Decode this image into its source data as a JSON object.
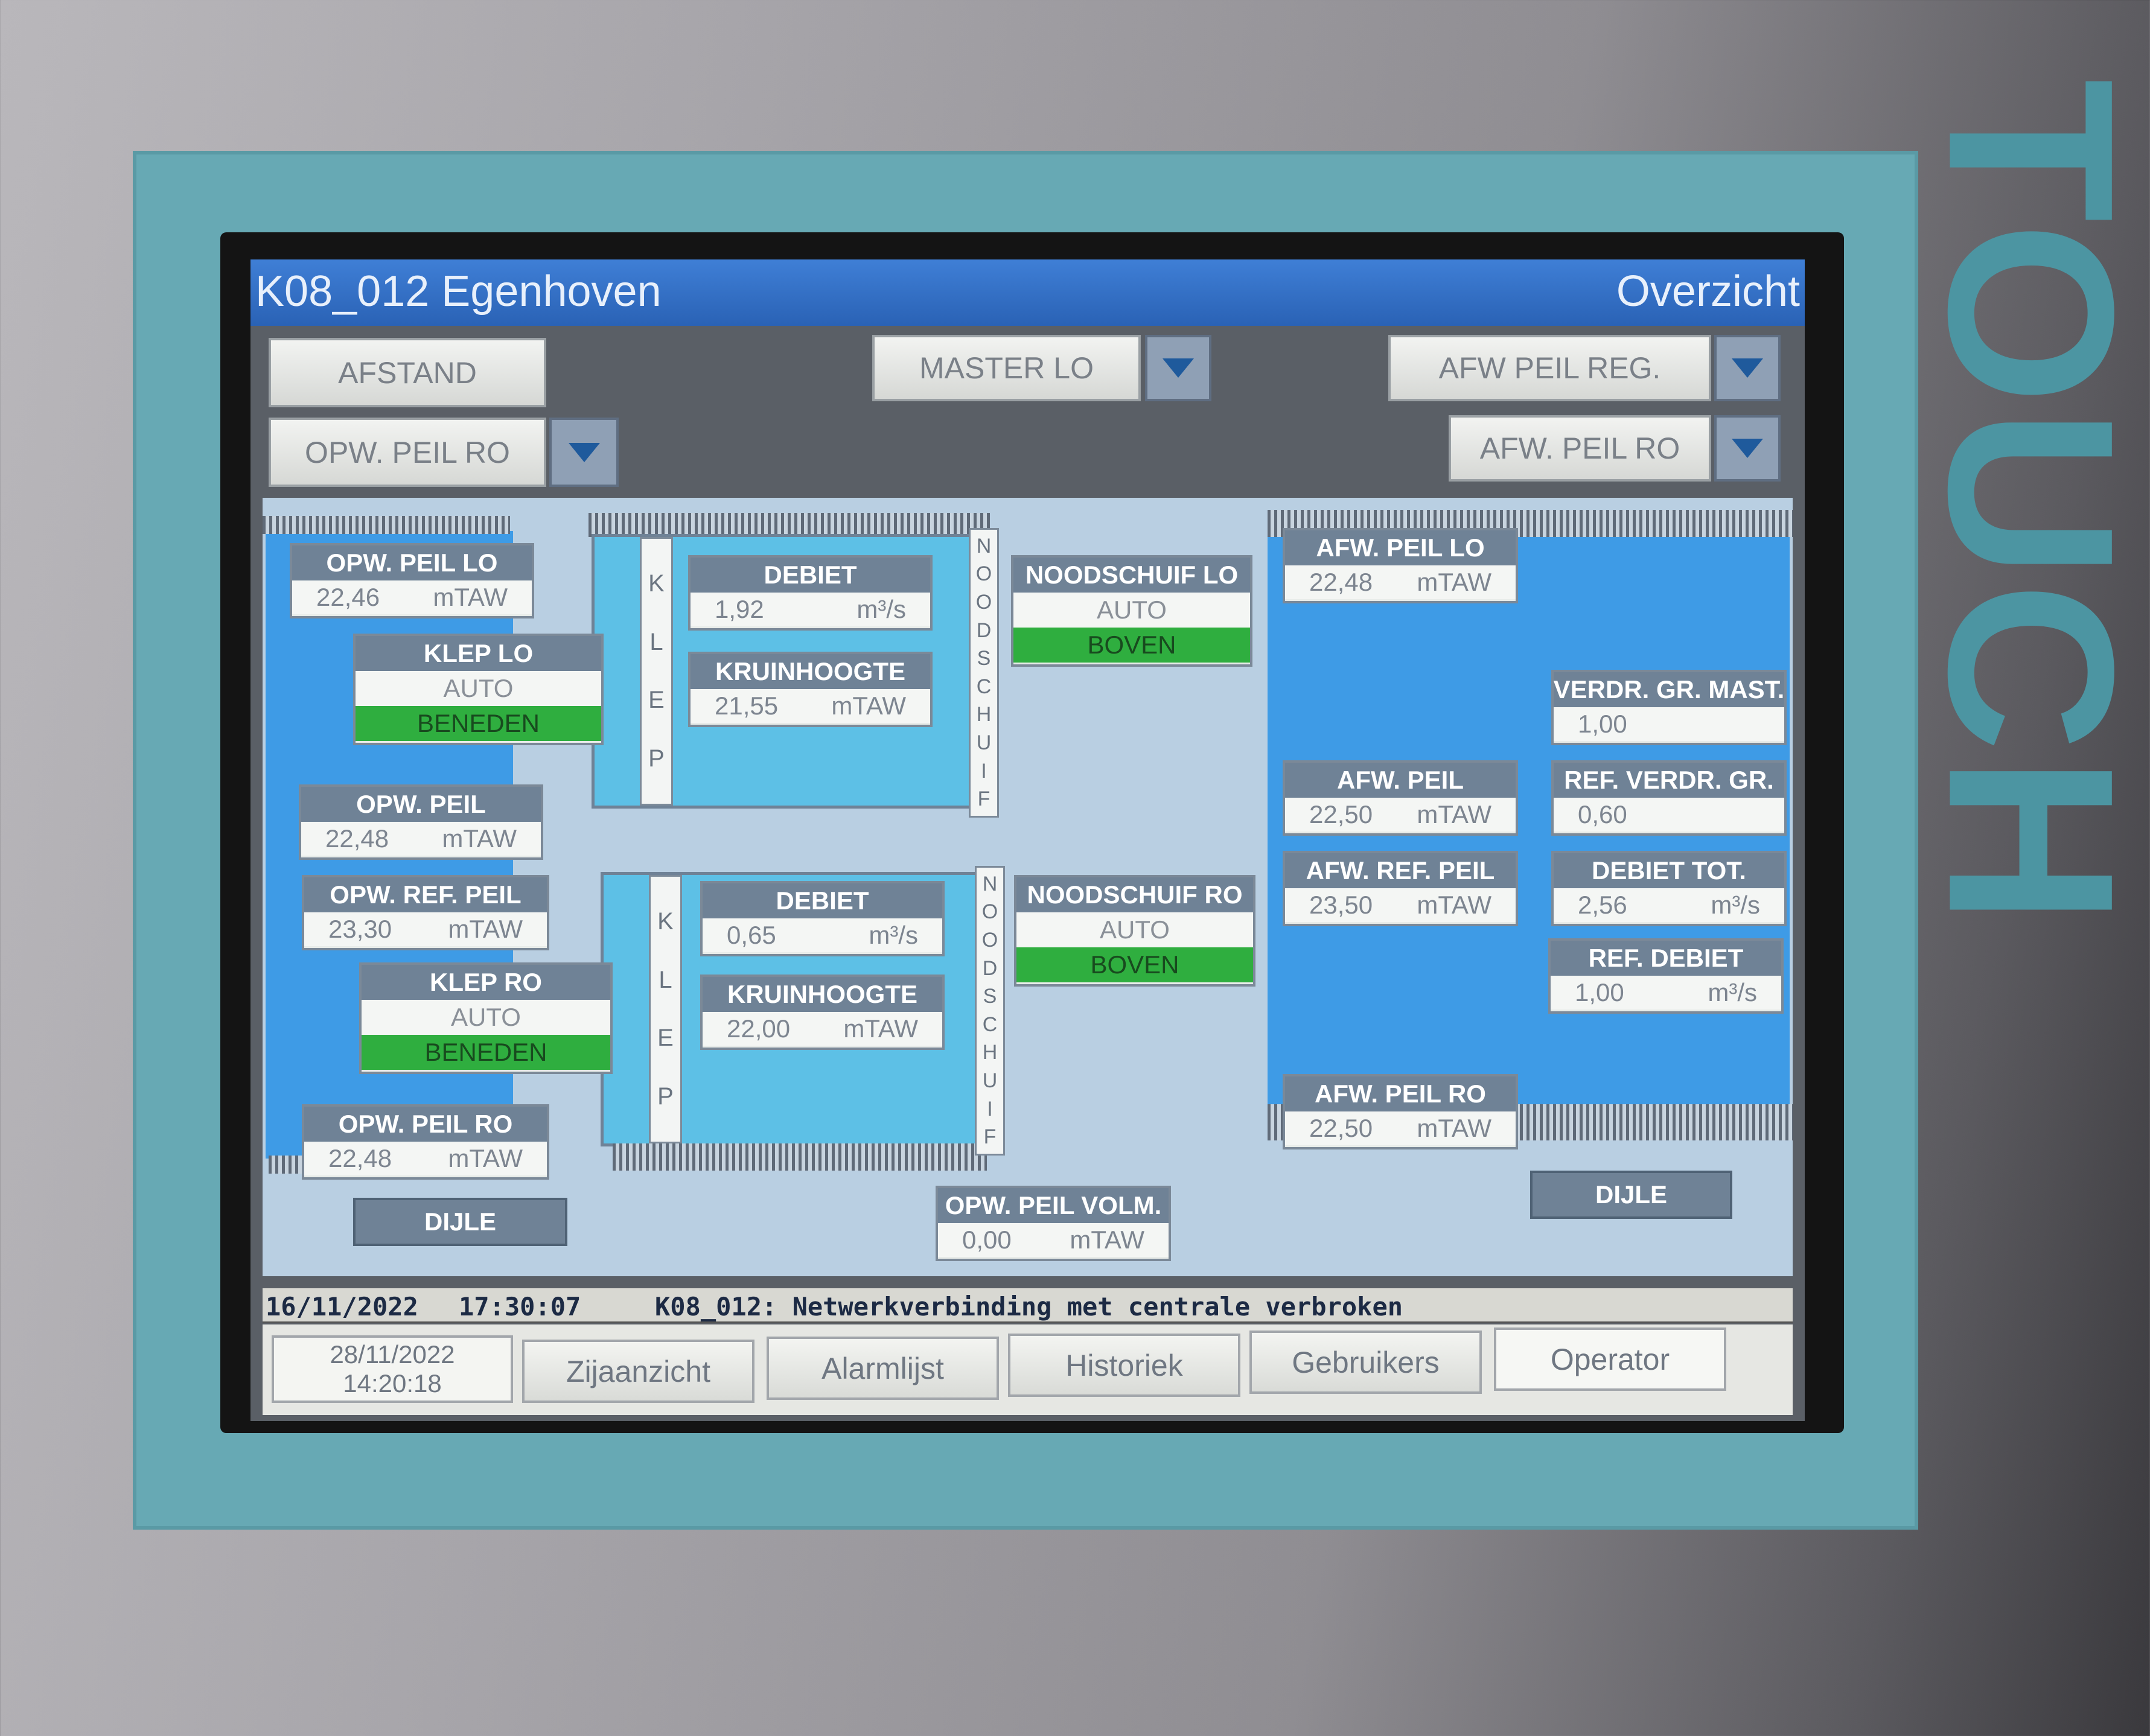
{
  "device": {
    "brand": "TOUCH"
  },
  "header": {
    "station": "K08_012 Egenhoven",
    "view": "Overzicht"
  },
  "controls": {
    "afstand": "AFSTAND",
    "master": "MASTER LO",
    "afw_peil_reg": "AFW PEIL REG.",
    "opw_peil_ro": "OPW. PEIL RO",
    "afw_peil_ro": "AFW. PEIL RO"
  },
  "left": {
    "opw_peil_lo": {
      "title": "OPW. PEIL LO",
      "value": "22,46",
      "unit": "mTAW"
    },
    "klep_lo": {
      "title": "KLEP LO",
      "mode": "AUTO",
      "state": "BENEDEN"
    },
    "opw_peil": {
      "title": "OPW. PEIL",
      "value": "22,48",
      "unit": "mTAW"
    },
    "opw_ref_peil": {
      "title": "OPW. REF. PEIL",
      "value": "23,30",
      "unit": "mTAW"
    },
    "klep_ro": {
      "title": "KLEP RO",
      "mode": "AUTO",
      "state": "BENEDEN"
    },
    "opw_peil_ro": {
      "title": "OPW. PEIL RO",
      "value": "22,48",
      "unit": "mTAW"
    },
    "river": "DIJLE"
  },
  "gate_top": {
    "klep_letters": [
      "K",
      "L",
      "E",
      "P"
    ],
    "debiet": {
      "title": "DEBIET",
      "value": "1,92",
      "unit": "m³/s"
    },
    "kruinhoogte": {
      "title": "KRUINHOOGTE",
      "value": "21,55",
      "unit": "mTAW"
    },
    "nood_letters": [
      "N",
      "O",
      "O",
      "D",
      "S",
      "C",
      "H",
      "U",
      "I",
      "F"
    ],
    "noodschuif": {
      "title": "NOODSCHUIF LO",
      "mode": "AUTO",
      "state": "BOVEN"
    }
  },
  "gate_bottom": {
    "klep_letters": [
      "K",
      "L",
      "E",
      "P"
    ],
    "debiet": {
      "title": "DEBIET",
      "value": "0,65",
      "unit": "m³/s"
    },
    "kruinhoogte": {
      "title": "KRUINHOOGTE",
      "value": "22,00",
      "unit": "mTAW"
    },
    "nood_letters": [
      "N",
      "O",
      "O",
      "D",
      "S",
      "C",
      "H",
      "U",
      "I",
      "F"
    ],
    "noodschuif": {
      "title": "NOODSCHUIF RO",
      "mode": "AUTO",
      "state": "BOVEN"
    }
  },
  "center": {
    "opw_peil_volm": {
      "title": "OPW. PEIL VOLM.",
      "value": "0,00",
      "unit": "mTAW"
    }
  },
  "right": {
    "afw_peil_lo": {
      "title": "AFW. PEIL LO",
      "value": "22,48",
      "unit": "mTAW"
    },
    "afw_peil": {
      "title": "AFW. PEIL",
      "value": "22,50",
      "unit": "mTAW"
    },
    "afw_ref_peil": {
      "title": "AFW. REF. PEIL",
      "value": "23,50",
      "unit": "mTAW"
    },
    "afw_peil_ro": {
      "title": "AFW. PEIL RO",
      "value": "22,50",
      "unit": "mTAW"
    },
    "verdr_gr_mast": {
      "title": "VERDR. GR. MAST.",
      "value": "1,00"
    },
    "ref_verdr_gr": {
      "title": "REF. VERDR. GR.",
      "value": "0,60"
    },
    "debiet_tot": {
      "title": "DEBIET TOT.",
      "value": "2,56",
      "unit": "m³/s"
    },
    "ref_debiet": {
      "title": "REF. DEBIET",
      "value": "1,00",
      "unit": "m³/s"
    },
    "river": "DIJLE"
  },
  "alarm": {
    "date": "16/11/2022",
    "time": "17:30:07",
    "message": "K08_012: Netwerkverbinding met centrale verbroken"
  },
  "footer": {
    "date": "28/11/2022",
    "time": "14:20:18",
    "nav": [
      "Zijaanzicht",
      "Alarmlijst",
      "Historiek",
      "Gebruikers",
      "Operator"
    ]
  }
}
